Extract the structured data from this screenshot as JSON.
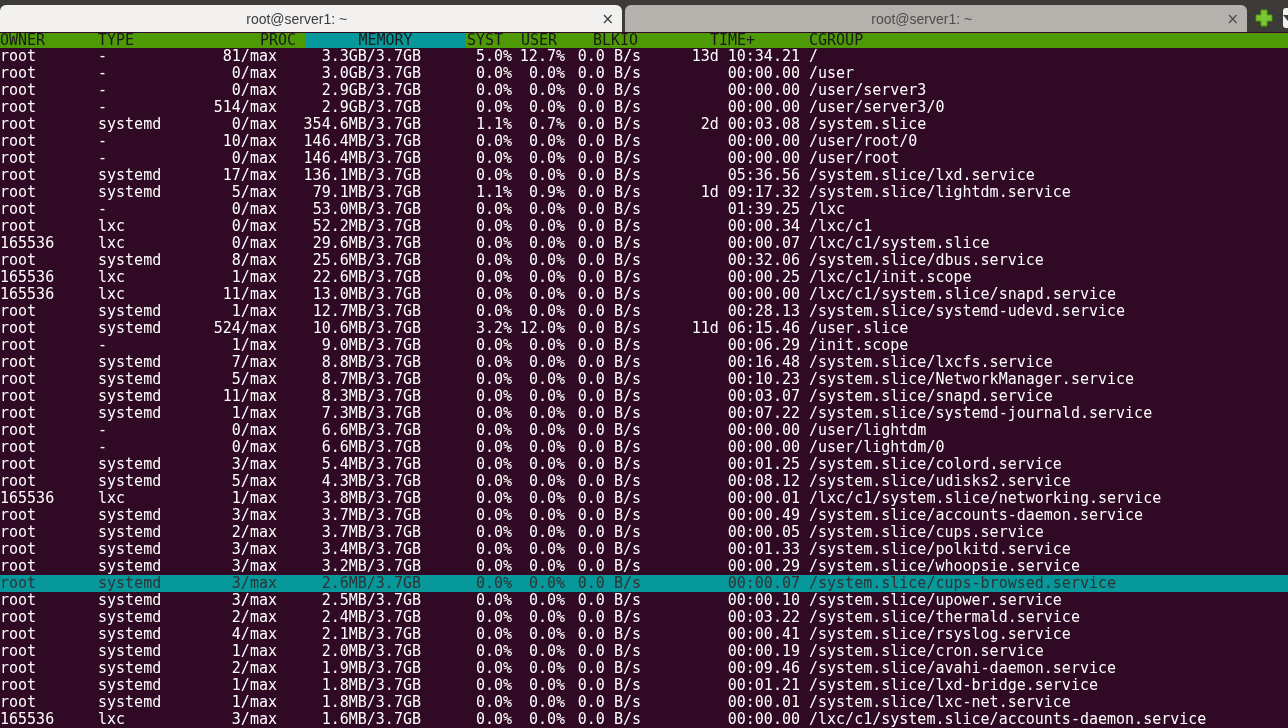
{
  "tabs": [
    {
      "title": "root@server1: ~",
      "selected": true,
      "close": "×"
    },
    {
      "title": "root@server1: ~",
      "selected": false,
      "close": "×"
    }
  ],
  "table": {
    "columns": [
      {
        "label": "OWNER",
        "selected": false
      },
      {
        "label": "TYPE",
        "selected": false
      },
      {
        "label": "PROC",
        "selected": false
      },
      {
        "label": "MEMORY",
        "selected": true
      },
      {
        "label": "SYST",
        "selected": false
      },
      {
        "label": "USER",
        "selected": false
      },
      {
        "label": "BLKIO",
        "selected": false
      },
      {
        "label": "TIME+",
        "selected": false
      },
      {
        "label": "CGROUP",
        "selected": false
      }
    ],
    "rows": [
      {
        "selected": false,
        "cells": [
          "root",
          "-",
          "81/max",
          "3.3GB/3.7GB",
          "5.0%",
          "12.7%",
          "0.0 B/s",
          "13d 10:34.21",
          "/"
        ]
      },
      {
        "selected": false,
        "cells": [
          "root",
          "-",
          "0/max",
          "3.0GB/3.7GB",
          "0.0%",
          "0.0%",
          "0.0 B/s",
          "00:00.00",
          "/user"
        ]
      },
      {
        "selected": false,
        "cells": [
          "root",
          "-",
          "0/max",
          "2.9GB/3.7GB",
          "0.0%",
          "0.0%",
          "0.0 B/s",
          "00:00.00",
          "/user/server3"
        ]
      },
      {
        "selected": false,
        "cells": [
          "root",
          "-",
          "514/max",
          "2.9GB/3.7GB",
          "0.0%",
          "0.0%",
          "0.0 B/s",
          "00:00.00",
          "/user/server3/0"
        ]
      },
      {
        "selected": false,
        "cells": [
          "root",
          "systemd",
          "0/max",
          "354.6MB/3.7GB",
          "1.1%",
          "0.7%",
          "0.0 B/s",
          "2d 00:03.08",
          "/system.slice"
        ]
      },
      {
        "selected": false,
        "cells": [
          "root",
          "-",
          "10/max",
          "146.4MB/3.7GB",
          "0.0%",
          "0.0%",
          "0.0 B/s",
          "00:00.00",
          "/user/root/0"
        ]
      },
      {
        "selected": false,
        "cells": [
          "root",
          "-",
          "0/max",
          "146.4MB/3.7GB",
          "0.0%",
          "0.0%",
          "0.0 B/s",
          "00:00.00",
          "/user/root"
        ]
      },
      {
        "selected": false,
        "cells": [
          "root",
          "systemd",
          "17/max",
          "136.1MB/3.7GB",
          "0.0%",
          "0.0%",
          "0.0 B/s",
          "05:36.56",
          "/system.slice/lxd.service"
        ]
      },
      {
        "selected": false,
        "cells": [
          "root",
          "systemd",
          "5/max",
          "79.1MB/3.7GB",
          "1.1%",
          "0.9%",
          "0.0 B/s",
          "1d 09:17.32",
          "/system.slice/lightdm.service"
        ]
      },
      {
        "selected": false,
        "cells": [
          "root",
          "-",
          "0/max",
          "53.0MB/3.7GB",
          "0.0%",
          "0.0%",
          "0.0 B/s",
          "01:39.25",
          "/lxc"
        ]
      },
      {
        "selected": false,
        "cells": [
          "root",
          "lxc",
          "0/max",
          "52.2MB/3.7GB",
          "0.0%",
          "0.0%",
          "0.0 B/s",
          "00:00.34",
          "/lxc/c1"
        ]
      },
      {
        "selected": false,
        "cells": [
          "165536",
          "lxc",
          "0/max",
          "29.6MB/3.7GB",
          "0.0%",
          "0.0%",
          "0.0 B/s",
          "00:00.07",
          "/lxc/c1/system.slice"
        ]
      },
      {
        "selected": false,
        "cells": [
          "root",
          "systemd",
          "8/max",
          "25.6MB/3.7GB",
          "0.0%",
          "0.0%",
          "0.0 B/s",
          "00:32.06",
          "/system.slice/dbus.service"
        ]
      },
      {
        "selected": false,
        "cells": [
          "165536",
          "lxc",
          "1/max",
          "22.6MB/3.7GB",
          "0.0%",
          "0.0%",
          "0.0 B/s",
          "00:00.25",
          "/lxc/c1/init.scope"
        ]
      },
      {
        "selected": false,
        "cells": [
          "165536",
          "lxc",
          "11/max",
          "13.0MB/3.7GB",
          "0.0%",
          "0.0%",
          "0.0 B/s",
          "00:00.00",
          "/lxc/c1/system.slice/snapd.service"
        ]
      },
      {
        "selected": false,
        "cells": [
          "root",
          "systemd",
          "1/max",
          "12.7MB/3.7GB",
          "0.0%",
          "0.0%",
          "0.0 B/s",
          "00:28.13",
          "/system.slice/systemd-udevd.service"
        ]
      },
      {
        "selected": false,
        "cells": [
          "root",
          "systemd",
          "524/max",
          "10.6MB/3.7GB",
          "3.2%",
          "12.0%",
          "0.0 B/s",
          "11d 06:15.46",
          "/user.slice"
        ]
      },
      {
        "selected": false,
        "cells": [
          "root",
          "-",
          "1/max",
          "9.0MB/3.7GB",
          "0.0%",
          "0.0%",
          "0.0 B/s",
          "00:06.29",
          "/init.scope"
        ]
      },
      {
        "selected": false,
        "cells": [
          "root",
          "systemd",
          "7/max",
          "8.8MB/3.7GB",
          "0.0%",
          "0.0%",
          "0.0 B/s",
          "00:16.48",
          "/system.slice/lxcfs.service"
        ]
      },
      {
        "selected": false,
        "cells": [
          "root",
          "systemd",
          "5/max",
          "8.7MB/3.7GB",
          "0.0%",
          "0.0%",
          "0.0 B/s",
          "00:10.23",
          "/system.slice/NetworkManager.service"
        ]
      },
      {
        "selected": false,
        "cells": [
          "root",
          "systemd",
          "11/max",
          "8.3MB/3.7GB",
          "0.0%",
          "0.0%",
          "0.0 B/s",
          "00:03.07",
          "/system.slice/snapd.service"
        ]
      },
      {
        "selected": false,
        "cells": [
          "root",
          "systemd",
          "1/max",
          "7.3MB/3.7GB",
          "0.0%",
          "0.0%",
          "0.0 B/s",
          "00:07.22",
          "/system.slice/systemd-journald.service"
        ]
      },
      {
        "selected": false,
        "cells": [
          "root",
          "-",
          "0/max",
          "6.6MB/3.7GB",
          "0.0%",
          "0.0%",
          "0.0 B/s",
          "00:00.00",
          "/user/lightdm"
        ]
      },
      {
        "selected": false,
        "cells": [
          "root",
          "-",
          "0/max",
          "6.6MB/3.7GB",
          "0.0%",
          "0.0%",
          "0.0 B/s",
          "00:00.00",
          "/user/lightdm/0"
        ]
      },
      {
        "selected": false,
        "cells": [
          "root",
          "systemd",
          "3/max",
          "5.4MB/3.7GB",
          "0.0%",
          "0.0%",
          "0.0 B/s",
          "00:01.25",
          "/system.slice/colord.service"
        ]
      },
      {
        "selected": false,
        "cells": [
          "root",
          "systemd",
          "5/max",
          "4.3MB/3.7GB",
          "0.0%",
          "0.0%",
          "0.0 B/s",
          "00:08.12",
          "/system.slice/udisks2.service"
        ]
      },
      {
        "selected": false,
        "cells": [
          "165536",
          "lxc",
          "1/max",
          "3.8MB/3.7GB",
          "0.0%",
          "0.0%",
          "0.0 B/s",
          "00:00.01",
          "/lxc/c1/system.slice/networking.service"
        ]
      },
      {
        "selected": false,
        "cells": [
          "root",
          "systemd",
          "3/max",
          "3.7MB/3.7GB",
          "0.0%",
          "0.0%",
          "0.0 B/s",
          "00:00.49",
          "/system.slice/accounts-daemon.service"
        ]
      },
      {
        "selected": false,
        "cells": [
          "root",
          "systemd",
          "2/max",
          "3.7MB/3.7GB",
          "0.0%",
          "0.0%",
          "0.0 B/s",
          "00:00.05",
          "/system.slice/cups.service"
        ]
      },
      {
        "selected": false,
        "cells": [
          "root",
          "systemd",
          "3/max",
          "3.4MB/3.7GB",
          "0.0%",
          "0.0%",
          "0.0 B/s",
          "00:01.33",
          "/system.slice/polkitd.service"
        ]
      },
      {
        "selected": false,
        "cells": [
          "root",
          "systemd",
          "3/max",
          "3.2MB/3.7GB",
          "0.0%",
          "0.0%",
          "0.0 B/s",
          "00:00.29",
          "/system.slice/whoopsie.service"
        ]
      },
      {
        "selected": true,
        "cells": [
          "root",
          "systemd",
          "3/max",
          "2.6MB/3.7GB",
          "0.0%",
          "0.0%",
          "0.0 B/s",
          "00:00.07",
          "/system.slice/cups-browsed.service"
        ]
      },
      {
        "selected": false,
        "cells": [
          "root",
          "systemd",
          "3/max",
          "2.5MB/3.7GB",
          "0.0%",
          "0.0%",
          "0.0 B/s",
          "00:00.10",
          "/system.slice/upower.service"
        ]
      },
      {
        "selected": false,
        "cells": [
          "root",
          "systemd",
          "2/max",
          "2.4MB/3.7GB",
          "0.0%",
          "0.0%",
          "0.0 B/s",
          "00:03.22",
          "/system.slice/thermald.service"
        ]
      },
      {
        "selected": false,
        "cells": [
          "root",
          "systemd",
          "4/max",
          "2.1MB/3.7GB",
          "0.0%",
          "0.0%",
          "0.0 B/s",
          "00:00.41",
          "/system.slice/rsyslog.service"
        ]
      },
      {
        "selected": false,
        "cells": [
          "root",
          "systemd",
          "1/max",
          "2.0MB/3.7GB",
          "0.0%",
          "0.0%",
          "0.0 B/s",
          "00:00.19",
          "/system.slice/cron.service"
        ]
      },
      {
        "selected": false,
        "cells": [
          "root",
          "systemd",
          "2/max",
          "1.9MB/3.7GB",
          "0.0%",
          "0.0%",
          "0.0 B/s",
          "00:09.46",
          "/system.slice/avahi-daemon.service"
        ]
      },
      {
        "selected": false,
        "cells": [
          "root",
          "systemd",
          "1/max",
          "1.8MB/3.7GB",
          "0.0%",
          "0.0%",
          "0.0 B/s",
          "00:01.21",
          "/system.slice/lxd-bridge.service"
        ]
      },
      {
        "selected": false,
        "cells": [
          "root",
          "systemd",
          "1/max",
          "1.8MB/3.7GB",
          "0.0%",
          "0.0%",
          "0.0 B/s",
          "00:00.01",
          "/system.slice/lxc-net.service"
        ]
      },
      {
        "selected": false,
        "cells": [
          "165536",
          "lxc",
          "3/max",
          "1.6MB/3.7GB",
          "0.0%",
          "0.0%",
          "0.0 B/s",
          "00:00.00",
          "/lxc/c1/system.slice/accounts-daemon.service"
        ]
      }
    ]
  }
}
